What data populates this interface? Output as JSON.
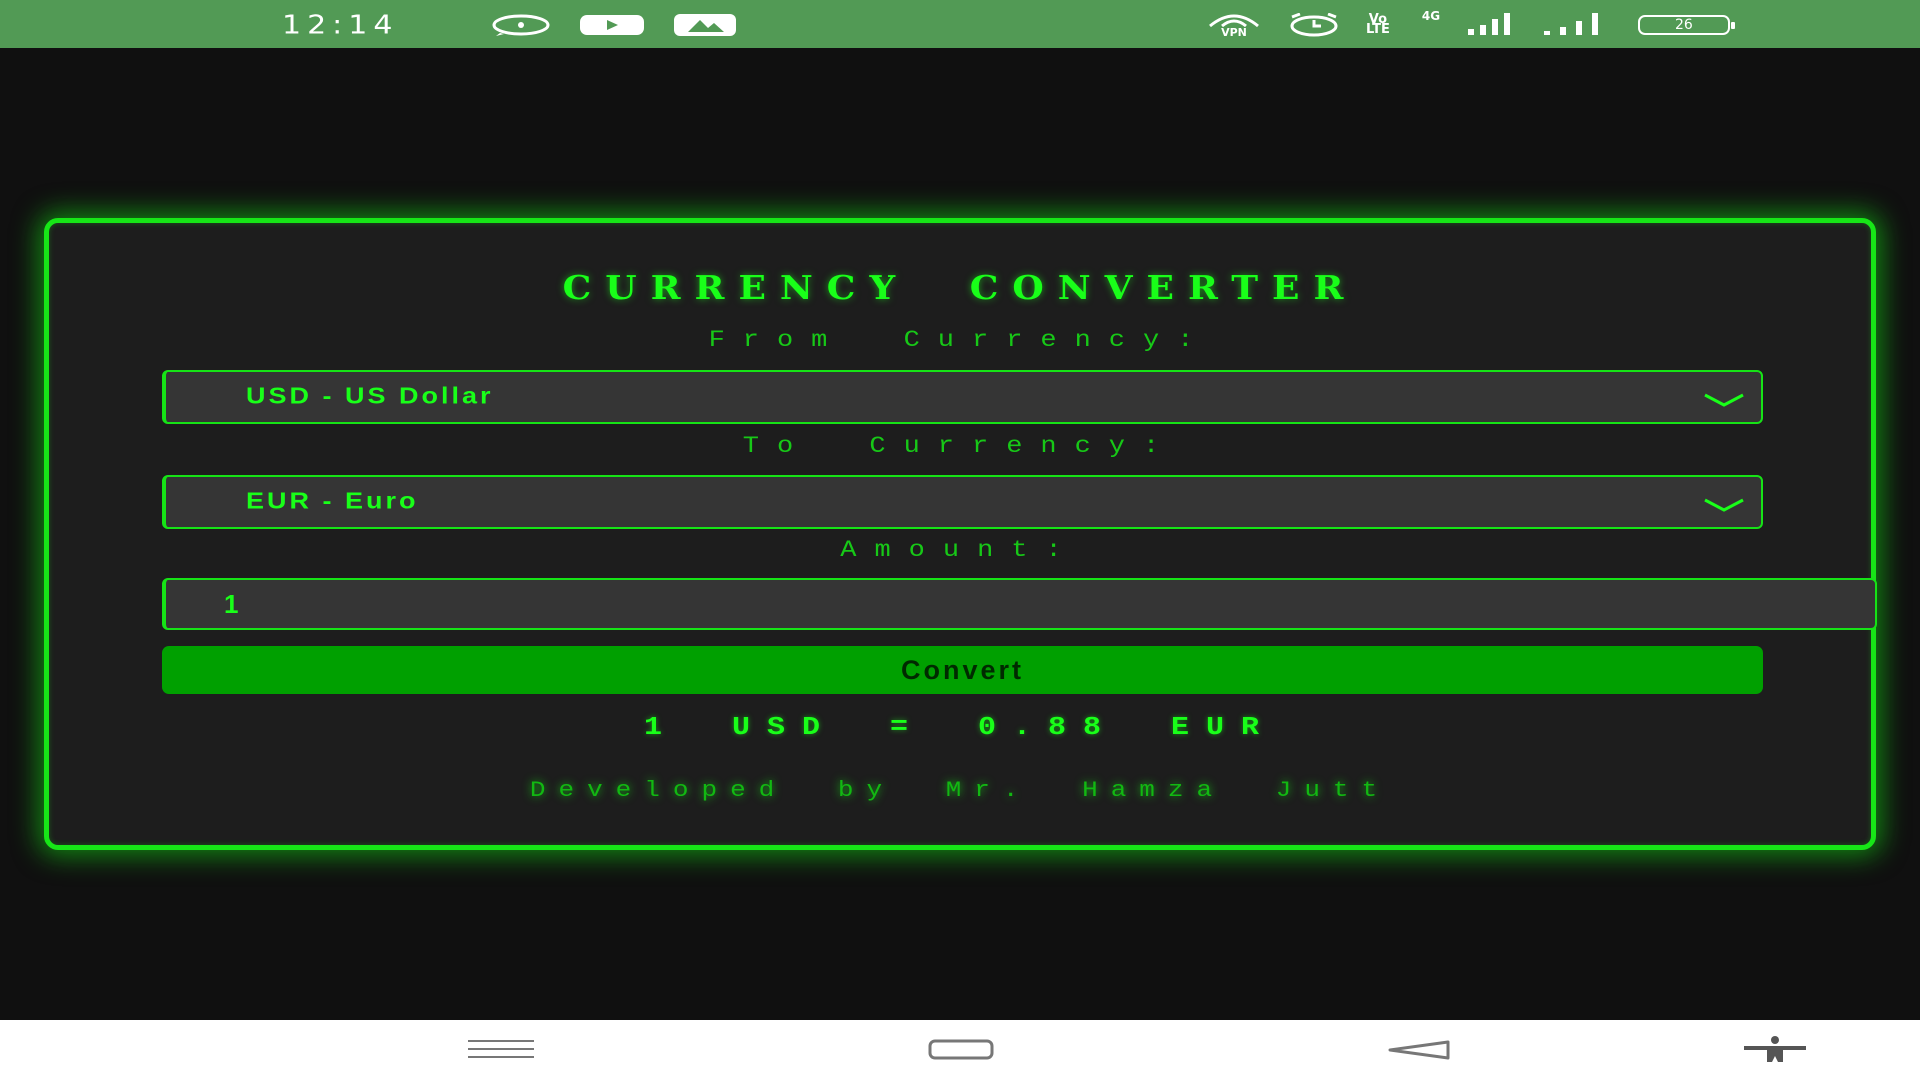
{
  "status_bar": {
    "time": "12:14",
    "left_icons": [
      "whatsapp-icon",
      "youtube-icon",
      "gallery-icon"
    ],
    "vpn_label": "VPN",
    "volte_label_top": "Vo",
    "volte_label_bottom": "LTE",
    "network_label": "4G",
    "battery_level": "26"
  },
  "converter": {
    "title": "CURRENCY CONVERTER",
    "from_label": "From Currency:",
    "from_value": "USD - US Dollar",
    "to_label": "To Currency:",
    "to_value": "EUR - Euro",
    "amount_label": "Amount:",
    "amount_value": "1",
    "convert_label": "Convert",
    "result": "1 USD = 0.88 EUR",
    "credit": "Developed by Mr. Hamza Jutt"
  },
  "nav_bar": {
    "buttons": [
      "menu-icon",
      "home-icon",
      "back-icon",
      "accessibility-icon"
    ]
  },
  "colors": {
    "accent": "#19ff19",
    "card_border": "#17e617",
    "button": "#00a000",
    "status_bar": "#529a55",
    "background": "#101010"
  }
}
